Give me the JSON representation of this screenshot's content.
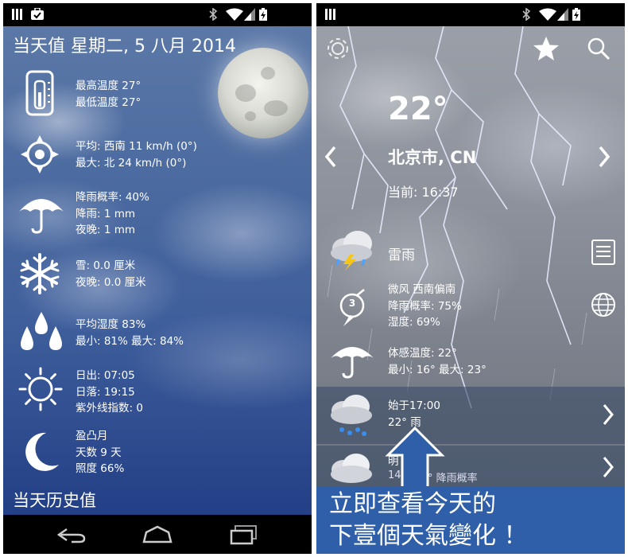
{
  "left_screen": {
    "title": "当天值 星期二, 5 八月 2014",
    "rows": [
      {
        "icon": "thermometer-icon",
        "lines": [
          "最高温度 27°",
          "最低温度 27°"
        ]
      },
      {
        "icon": "wind-compass-icon",
        "lines": [
          "平均: 西南 11 km/h (0°)",
          "最大: 北 24 km/h (0°)"
        ]
      },
      {
        "icon": "umbrella-icon",
        "lines": [
          "降雨概率: 40%",
          "降雨: 1 mm",
          "夜晚: 1 mm"
        ]
      },
      {
        "icon": "snowflake-icon",
        "lines": [
          "雪: 0.0 厘米",
          "夜晚: 0.0 厘米"
        ]
      },
      {
        "icon": "humidity-drops-icon",
        "lines": [
          "平均湿度 83%",
          "最小: 81% 最大: 84%"
        ]
      },
      {
        "icon": "sun-icon",
        "lines": [
          "日出: 07:05",
          "日落: 19:15",
          "紫外线指数: 0"
        ]
      },
      {
        "icon": "crescent-moon-icon",
        "lines": [
          "盈凸月",
          "天数 9 天",
          "照度 66%"
        ]
      }
    ],
    "history_label": "当天历史值"
  },
  "right_screen": {
    "temperature": "22°",
    "city": "北京市, CN",
    "current_time": "当前: 16:37",
    "condition": "雷雨",
    "wind_block": {
      "wind_speed_badge": "3",
      "lines": [
        "微风 西南偏南",
        "降雨概率: 75%",
        "湿度: 69%"
      ]
    },
    "feels_block": {
      "lines": [
        "体感温度: 22°",
        "最小: 16° 最大: 23°"
      ]
    },
    "forecast_rows": [
      {
        "lines": [
          "始于17:00",
          "22° 雨"
        ]
      },
      {
        "lines": [
          "明",
          "14",
          "° 降雨概率"
        ]
      }
    ],
    "banner": [
      "立即查看今天的",
      "下壹個天氣變化 ！"
    ]
  },
  "colors": {
    "banner_blue": "#2e5fa8",
    "left_sky": "#3f5f9c",
    "status_bar": "#000000"
  }
}
